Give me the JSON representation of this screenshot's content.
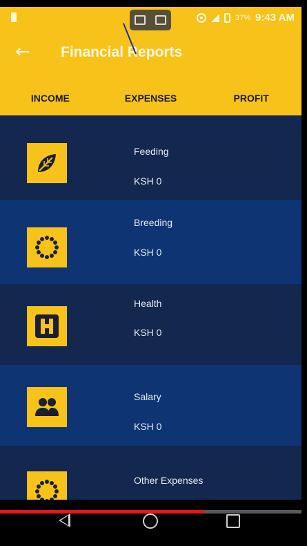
{
  "status": {
    "battery": "37%",
    "time": "9:43 AM"
  },
  "toolbar": {
    "title": "Financial Reports"
  },
  "tabs": [
    {
      "label": "INCOME",
      "selected": false
    },
    {
      "label": "EXPENSES",
      "selected": true
    },
    {
      "label": "PROFIT",
      "selected": false
    }
  ],
  "expenses": [
    {
      "name": "Feeding",
      "amount": "KSH 0",
      "icon": "leaf-icon"
    },
    {
      "name": "Breeding",
      "amount": "KSH 0",
      "icon": "sun-dots-icon"
    },
    {
      "name": "Health",
      "amount": "KSH 0",
      "icon": "hospital-icon"
    },
    {
      "name": "Salary",
      "amount": "KSH 0",
      "icon": "people-icon"
    },
    {
      "name": "Other Expenses",
      "amount": "",
      "icon": "sun-dots-icon"
    }
  ],
  "video_progress": 0.68,
  "colors": {
    "accent": "#f7c21a",
    "row_dark": "#13274f",
    "row_light": "#0e3474",
    "progress": "#e11b1b"
  }
}
